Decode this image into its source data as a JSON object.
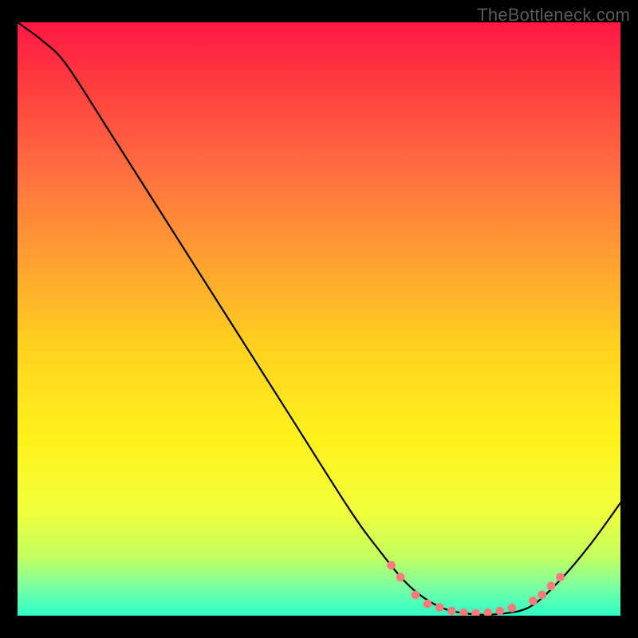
{
  "watermark": "TheBottleneck.com",
  "chart_data": {
    "type": "line",
    "title": "",
    "xlabel": "",
    "ylabel": "",
    "xlim": [
      0,
      100
    ],
    "ylim": [
      0,
      100
    ],
    "curve": [
      {
        "x": 0,
        "y": 100
      },
      {
        "x": 4,
        "y": 97
      },
      {
        "x": 8,
        "y": 93
      },
      {
        "x": 15,
        "y": 82
      },
      {
        "x": 25,
        "y": 66
      },
      {
        "x": 35,
        "y": 50
      },
      {
        "x": 45,
        "y": 34
      },
      {
        "x": 55,
        "y": 18
      },
      {
        "x": 60,
        "y": 11
      },
      {
        "x": 65,
        "y": 5
      },
      {
        "x": 70,
        "y": 1.5
      },
      {
        "x": 75,
        "y": 0.3
      },
      {
        "x": 80,
        "y": 0.3
      },
      {
        "x": 85,
        "y": 1.5
      },
      {
        "x": 90,
        "y": 6
      },
      {
        "x": 95,
        "y": 12
      },
      {
        "x": 100,
        "y": 19
      }
    ],
    "markers": [
      {
        "x": 62,
        "y": 8.5
      },
      {
        "x": 63.5,
        "y": 6.5
      },
      {
        "x": 66,
        "y": 3.5
      },
      {
        "x": 68,
        "y": 2
      },
      {
        "x": 70,
        "y": 1.4
      },
      {
        "x": 72,
        "y": 0.8
      },
      {
        "x": 74,
        "y": 0.5
      },
      {
        "x": 76,
        "y": 0.4
      },
      {
        "x": 78,
        "y": 0.5
      },
      {
        "x": 80,
        "y": 0.8
      },
      {
        "x": 82,
        "y": 1.3
      },
      {
        "x": 85.5,
        "y": 2.5
      },
      {
        "x": 87,
        "y": 3.5
      },
      {
        "x": 88.5,
        "y": 5
      },
      {
        "x": 90,
        "y": 6.5
      }
    ],
    "gradient_stops": [
      {
        "offset": 0.0,
        "color": "#ff1744"
      },
      {
        "offset": 0.1,
        "color": "#ff3b3f"
      },
      {
        "offset": 0.25,
        "color": "#ff6e40"
      },
      {
        "offset": 0.4,
        "color": "#ffa030"
      },
      {
        "offset": 0.55,
        "color": "#ffd21f"
      },
      {
        "offset": 0.7,
        "color": "#fff11c"
      },
      {
        "offset": 0.82,
        "color": "#f2ff3a"
      },
      {
        "offset": 0.9,
        "color": "#c4ff5e"
      },
      {
        "offset": 0.95,
        "color": "#7dffa0"
      },
      {
        "offset": 1.0,
        "color": "#2dffc8"
      }
    ],
    "marker_color": "#ff7a7a",
    "curve_color": "#000000",
    "curve_width": 2.2
  }
}
